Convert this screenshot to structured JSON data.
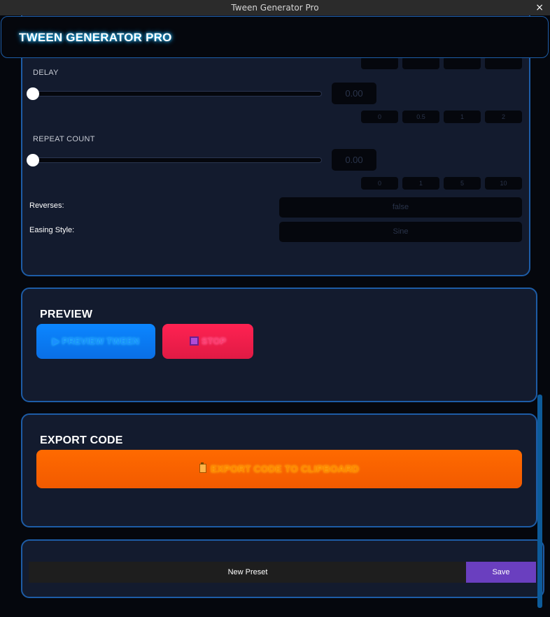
{
  "window": {
    "title": "Tween Generator Pro",
    "close_label": "×"
  },
  "header": {
    "title": "TWEEN GENERATOR PRO"
  },
  "settings": {
    "delay": {
      "label": "DELAY",
      "value": "0.00",
      "fraction": 0.0,
      "presets": [
        "0",
        "0.5",
        "1",
        "2"
      ]
    },
    "repeat_count": {
      "label": "REPEAT COUNT",
      "value": "0.00",
      "fraction": 0.0,
      "presets": [
        "0",
        "1",
        "5",
        "10"
      ]
    },
    "reverses": {
      "label": "Reverses:",
      "value": "false"
    },
    "easing_style": {
      "label": "Easing Style:",
      "value": "Sine"
    }
  },
  "preview": {
    "title": "PREVIEW",
    "preview_button": "▶ PREVIEW TWEEN",
    "stop_button": "STOP"
  },
  "export": {
    "title": "EXPORT CODE",
    "export_button": "EXPORT CODE TO CLIPBOARD"
  },
  "presets": {
    "name_placeholder": "New Preset",
    "save_label": "Save"
  },
  "colors": {
    "accent_border": "#1d5ca6",
    "panel_bg": "#131b2e",
    "preview_blue": "#0b86ff",
    "stop_red": "#ff2252",
    "export_orange": "#ff6a00",
    "save_purple": "#6a3fbf"
  }
}
